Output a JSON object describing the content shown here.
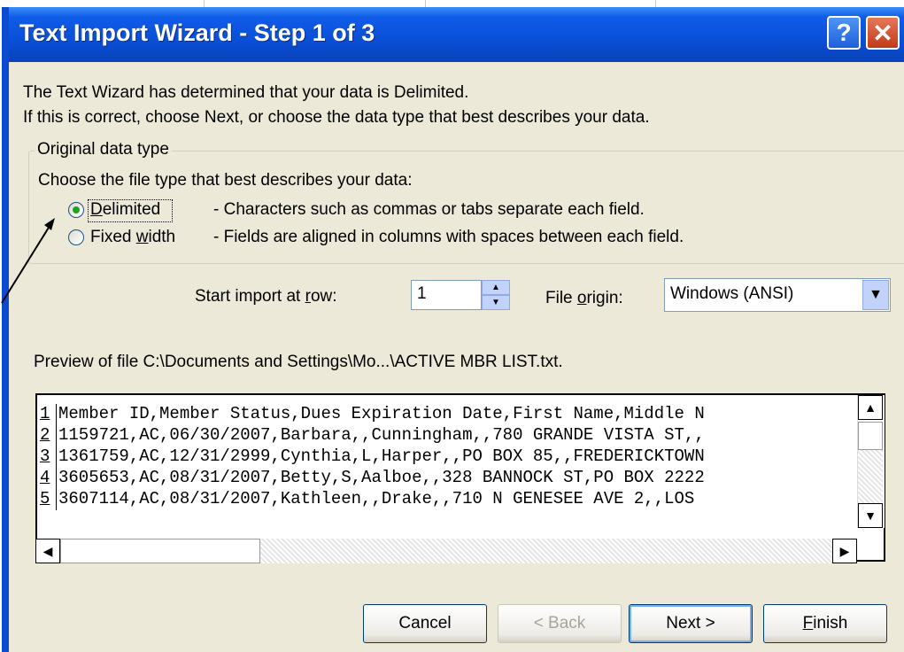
{
  "window": {
    "title": "Text Import Wizard - Step 1 of 3",
    "help_glyph": "?",
    "close_glyph": "✕"
  },
  "intro": {
    "line1": "The Text Wizard has determined that your data is Delimited.",
    "line2": "If this is correct, choose Next, or choose the data type that best describes your data."
  },
  "data_type_group": {
    "legend": "Original data type",
    "prompt": "Choose the file type that best describes your data:",
    "options": [
      {
        "label_pre": "",
        "label_accel": "D",
        "label_post": "elimited",
        "description": "- Characters such as commas or tabs separate each field.",
        "selected": true
      },
      {
        "label_pre": "Fixed ",
        "label_accel": "w",
        "label_post": "idth",
        "description": "- Fields are aligned in columns with spaces between each field.",
        "selected": false
      }
    ]
  },
  "start_row": {
    "label_pre": "Start import at ",
    "label_accel": "r",
    "label_post": "ow:",
    "value": "1"
  },
  "file_origin": {
    "label_pre": "File ",
    "label_accel": "o",
    "label_post": "rigin:",
    "value": "Windows (ANSI)"
  },
  "preview": {
    "caption": "Preview of file C:\\Documents and Settings\\Mo...\\ACTIVE MBR LIST.txt.",
    "lines": [
      {
        "num": "1",
        "text": "Member ID,Member Status,Dues Expiration Date,First Name,Middle N"
      },
      {
        "num": "2",
        "text": "1159721,AC,06/30/2007,Barbara,,Cunningham,,780 GRANDE VISTA ST,,"
      },
      {
        "num": "3",
        "text": "1361759,AC,12/31/2999,Cynthia,L,Harper,,PO BOX 85,,FREDERICKTOWN"
      },
      {
        "num": "4",
        "text": "3605653,AC,08/31/2007,Betty,S,Aalboe,,328 BANNOCK ST,PO BOX 2222"
      },
      {
        "num": "5",
        "text": "3607114,AC,08/31/2007,Kathleen,,Drake,,710 N GENESEE AVE  2,,LOS"
      }
    ]
  },
  "buttons": {
    "cancel": "Cancel",
    "back": "< Back",
    "next": "Next >",
    "finish_accel": "F",
    "finish_rest": "inish"
  },
  "icons": {
    "scroll_up": "▲",
    "scroll_down": "▼",
    "scroll_left": "◀",
    "scroll_right": "▶",
    "dropdown": "▼"
  }
}
